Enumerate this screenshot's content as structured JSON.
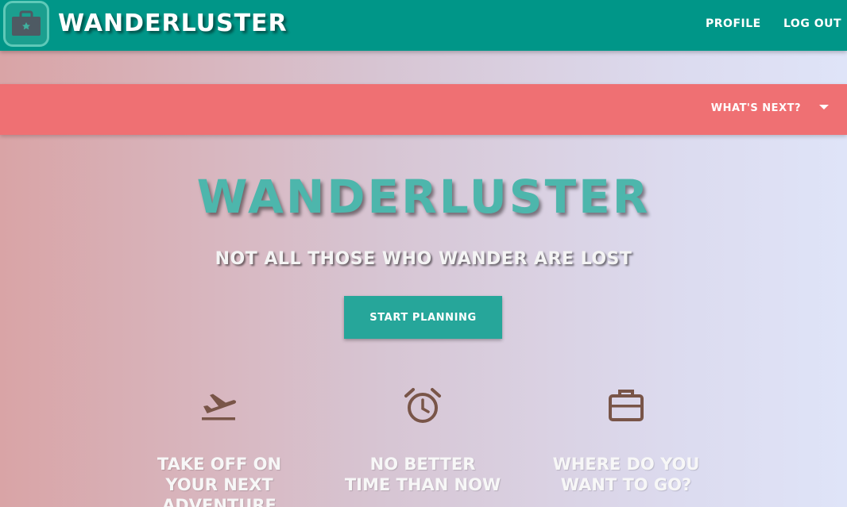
{
  "nav": {
    "brand": "WANDERLUSTER",
    "logo_icon": "briefcase-icon",
    "links": [
      "PROFILE",
      "LOG OUT"
    ]
  },
  "banner": {
    "dropdown_label": "WHAT'S NEXT?",
    "dropdown_icon": "caret-down-icon"
  },
  "hero": {
    "title": "WANDERLUSTER",
    "subtitle": "NOT ALL THOSE WHO WANDER ARE LOST",
    "cta": "START PLANNING"
  },
  "features": [
    {
      "icon": "flight-takeoff-icon",
      "lines": [
        "TAKE OFF ON",
        "YOUR NEXT",
        "ADVENTURE"
      ]
    },
    {
      "icon": "alarm-clock-icon",
      "lines": [
        "NO BETTER",
        "TIME THAN NOW"
      ]
    },
    {
      "icon": "work-briefcase-icon",
      "lines": [
        "WHERE DO YOU",
        "WANT TO GO?"
      ]
    }
  ],
  "colors": {
    "nav": "#009688",
    "banner": "#ef7073",
    "accent": "#4db6ac",
    "button": "#26a69a",
    "icon": "#795548"
  }
}
